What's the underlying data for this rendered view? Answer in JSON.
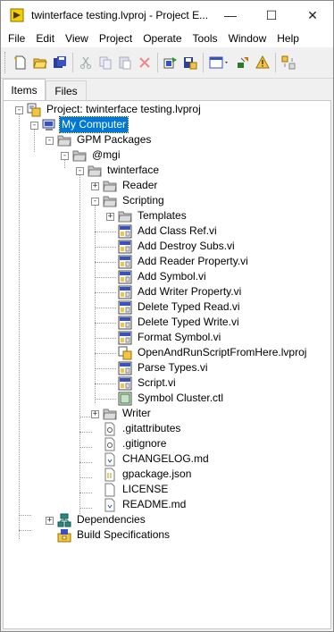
{
  "window": {
    "title": "twinterface testing.lvproj - Project E..."
  },
  "window_controls": {
    "minimize": "—",
    "maximize": "☐",
    "close": "✕"
  },
  "menu": [
    "File",
    "Edit",
    "View",
    "Project",
    "Operate",
    "Tools",
    "Window",
    "Help"
  ],
  "toolbar": {
    "groups": [
      [
        "new-file-icon",
        "open-folder-icon",
        "save-all-icon"
      ],
      [
        "cut-icon",
        "copy-icon",
        "paste-icon",
        "delete-icon"
      ],
      [
        "build-icon",
        "save-project-icon"
      ],
      [
        "view-menu-icon",
        "filter-icon",
        "warning-icon"
      ],
      [
        "arrange-icon"
      ]
    ]
  },
  "tabs": {
    "items": "Items",
    "files": "Files"
  },
  "tree": {
    "project": "Project: twinterface testing.lvproj",
    "my_computer": "My Computer",
    "gpm_packages": "GPM Packages",
    "mgi": "@mgi",
    "twinterface": "twinterface",
    "reader": "Reader",
    "scripting": "Scripting",
    "templates": "Templates",
    "scripting_vis": [
      "Add Class Ref.vi",
      "Add Destroy Subs.vi",
      "Add Reader Property.vi",
      "Add Symbol.vi",
      "Add Writer Property.vi",
      "Delete Typed Read.vi",
      "Delete Typed Write.vi",
      "Format Symbol.vi",
      "OpenAndRunScriptFromHere.lvproj",
      "Parse Types.vi",
      "Script.vi",
      "Symbol Cluster.ctl"
    ],
    "writer": "Writer",
    "files": [
      ".gitattributes",
      ".gitignore",
      "CHANGELOG.md",
      "gpackage.json",
      "LICENSE",
      "README.md"
    ],
    "dependencies": "Dependencies",
    "build_specs": "Build Specifications"
  }
}
